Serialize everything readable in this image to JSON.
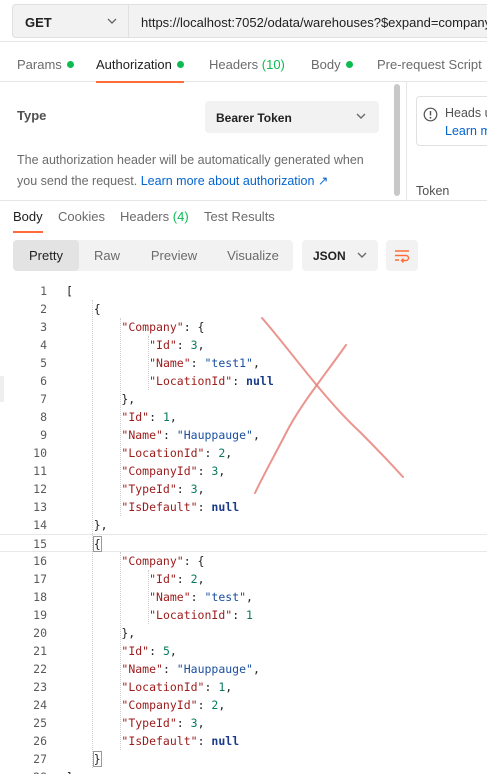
{
  "request": {
    "method": "GET",
    "url": "https://localhost:7052/odata/warehouses?$expand=company"
  },
  "request_tabs": [
    {
      "label": "Params",
      "dot": true
    },
    {
      "label": "Authorization",
      "dot": true
    },
    {
      "label": "Headers",
      "count": "(10)"
    },
    {
      "label": "Body",
      "dot": true
    },
    {
      "label": "Pre-request Script"
    }
  ],
  "auth": {
    "type_label": "Type",
    "type_value": "Bearer Token",
    "description": "The authorization header will be automatically generated when you send the request.",
    "learn_more": "Learn more about authorization ↗",
    "info_line1": "Heads u",
    "info_line2": "Learn m",
    "token_label": "Token"
  },
  "response_tabs": [
    {
      "label": "Body"
    },
    {
      "label": "Cookies"
    },
    {
      "label": "Headers",
      "count": "(4)"
    },
    {
      "label": "Test Results"
    }
  ],
  "view_modes": [
    "Pretty",
    "Raw",
    "Preview",
    "Visualize"
  ],
  "format": "JSON",
  "code_lines": [
    "[",
    "    {",
    "        \"Company\": {",
    "            \"Id\": 3,",
    "            \"Name\": \"test1\",",
    "            \"LocationId\": null",
    "        },",
    "        \"Id\": 1,",
    "        \"Name\": \"Hauppauge\",",
    "        \"LocationId\": 2,",
    "        \"CompanyId\": 3,",
    "        \"TypeId\": 3,",
    "        \"IsDefault\": null",
    "    },",
    "    {",
    "        \"Company\": {",
    "            \"Id\": 2,",
    "            \"Name\": \"test\",",
    "            \"LocationId\": 1",
    "        },",
    "        \"Id\": 5,",
    "        \"Name\": \"Hauppauge\",",
    "        \"LocationId\": 1,",
    "        \"CompanyId\": 2,",
    "        \"TypeId\": 3,",
    "        \"IsDefault\": null",
    "    }",
    "]"
  ],
  "colors": {
    "accent": "#ff6c37",
    "status_dot": "#0cbb52",
    "link": "#0265d2",
    "scribble": "#e8817a"
  }
}
